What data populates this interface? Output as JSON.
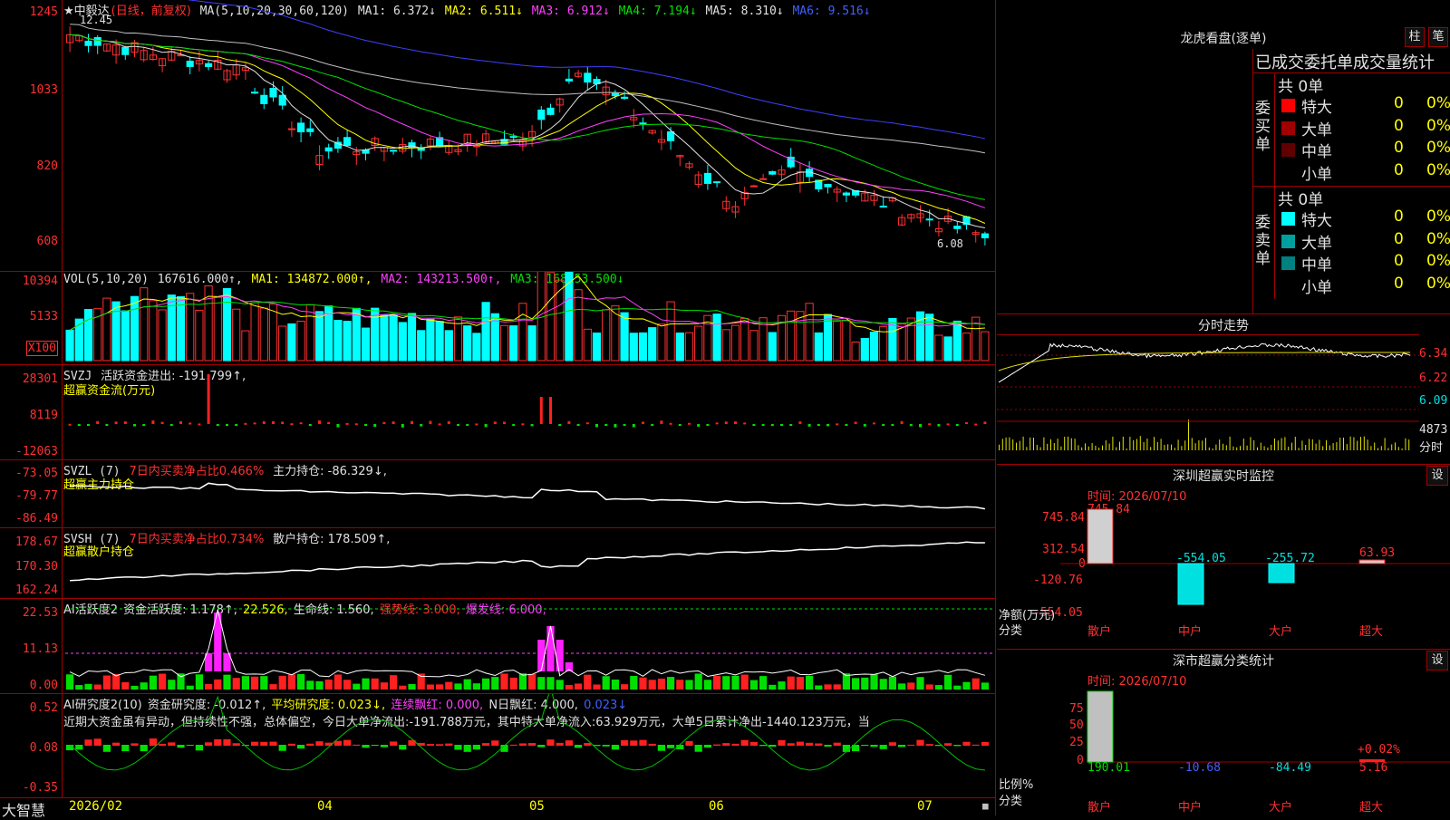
{
  "main": {
    "stock": "★中毅达",
    "period": "(日线，前复权)",
    "ma_label": "MA(5,10,20,30,60,120)",
    "ma1": "MA1: 6.372↓",
    "ma2": "MA2: 6.511↓",
    "ma3": "MA3: 6.912↓",
    "ma4": "MA4: 7.194↓",
    "ma5": "MA5: 8.310↓",
    "ma6": "MA6: 9.516↓",
    "high_mark": "12.45",
    "low_mark": "6.08",
    "y_labels": [
      "1245",
      "1033",
      "820",
      "608"
    ],
    "colors": {
      "ma1": "#e0e0e0",
      "ma2": "#ffff00",
      "ma3": "#ff40ff",
      "ma4": "#00e000",
      "ma5": "#c0c0c0",
      "ma6": "#4040ff"
    }
  },
  "vol": {
    "label": "VOL(5,10,20)",
    "value": "167616.000↑,",
    "ma1": "MA1: 134872.000↑,",
    "ma2": "MA2: 143213.500↑,",
    "ma3": "MA3: 168153.500↓",
    "y_labels": [
      "10394",
      "5133"
    ],
    "unit": "X100"
  },
  "svzj": {
    "label": "SVZJ",
    "title": "活跃资金进出: -191.799↑,",
    "sub": "超赢资金流(万元)",
    "y_labels": [
      "28301",
      "8119",
      "-12063"
    ]
  },
  "svzl": {
    "label": "SVZL (7)",
    "title": "7日内买卖净占比0.466%",
    "hold": "主力持仓: -86.329↓,",
    "sub": "超赢主力持仓",
    "y_labels": [
      "-73.05",
      "-79.77",
      "-86.49"
    ]
  },
  "svsh": {
    "label": "SVSH (7)",
    "title": "7日内买卖净占比0.734%",
    "hold": "散户持仓: 178.509↑,",
    "sub": "超赢散户持仓",
    "y_labels": [
      "178.67",
      "170.30",
      "162.24"
    ]
  },
  "ai1": {
    "label": "AI活跃度2",
    "t1": "资金活跃度: 1.178↑,",
    "t2": "22.526,",
    "t3": "生命线: 1.560,",
    "t4": "强势线: 3.000,",
    "t5": "爆发线: 6.000,",
    "y_labels": [
      "22.53",
      "11.13",
      "0.00"
    ]
  },
  "ai2": {
    "label": "AI研究度2(10)",
    "t1": "资金研究度: -0.012↑,",
    "t2": "平均研究度: 0.023↓,",
    "t3": "连续飘红: 0.000,",
    "t4": "N日飘红: 4.000,",
    "t5": "0.023↓",
    "comment": "近期大资金虽有异动，但持续性不强，总体偏空，今日大单净流出:-191.788万元，其中特大单净流入:63.929万元，大单5日累计净出-1440.123万元，当",
    "y_labels": [
      "0.52",
      "0.08",
      "-0.35"
    ]
  },
  "xaxis": {
    "brand": "大智慧",
    "labels": [
      "2026/02",
      "04",
      "05",
      "06",
      "07"
    ]
  },
  "right": {
    "lhb_title": "龙虎看盘(逐单)",
    "btn_zhu": "柱",
    "btn_bi": "笔",
    "stat_title": "已成交委托单成交量统计",
    "buy_side": "委买单",
    "sell_side": "委卖单",
    "buy_total": "共 0单",
    "sell_total": "共 0单",
    "buy_rows": [
      {
        "name": "特大",
        "count": "0",
        "pct": "0%",
        "color": "#ff0000"
      },
      {
        "name": "大单",
        "count": "0",
        "pct": "0%",
        "color": "#a00000"
      },
      {
        "name": "中单",
        "count": "0",
        "pct": "0%",
        "color": "#600000"
      },
      {
        "name": "小单",
        "count": "0",
        "pct": "0%",
        "color": "#000000"
      }
    ],
    "sell_rows": [
      {
        "name": "特大",
        "count": "0",
        "pct": "0%",
        "color": "#00ffff"
      },
      {
        "name": "大单",
        "count": "0",
        "pct": "0%",
        "color": "#00a0a0"
      },
      {
        "name": "中单",
        "count": "0",
        "pct": "0%",
        "color": "#008080"
      },
      {
        "name": "小单",
        "count": "0",
        "pct": "0%",
        "color": "#000000"
      }
    ],
    "ts_title": "分时走势",
    "ts_labels": [
      "6.34",
      "6.22",
      "6.09"
    ],
    "ts_vol": "4873",
    "ts_unit": "分时",
    "mon_title": "深圳超赢实时监控",
    "mon_btn": "设",
    "mon_time": "时间: 2026/07/10",
    "mon_y": [
      "745.84",
      "312.54",
      "0",
      "-120.76",
      "-554.05"
    ],
    "mon_vals": [
      "745.84",
      "-554.05",
      "-255.72",
      "63.93"
    ],
    "mon_ylabel": "净额(万元)",
    "mon_xlabel": "分类",
    "cat_labels": [
      "散户",
      "中户",
      "大户",
      "超大"
    ],
    "cls_title": "深市超赢分类统计",
    "cls_btn": "设",
    "cls_time": "时间: 2026/07/10",
    "cls_y": [
      "75",
      "50",
      "25",
      "0"
    ],
    "cls_vals": [
      "190.01",
      "-10.68",
      "-84.49",
      "5.16"
    ],
    "cls_top": "+0.02%",
    "cls_ylabel": "比例%",
    "cls_xlabel": "分类"
  },
  "chart_data": {
    "type": "candlestick",
    "title": "中毅达",
    "candles_x": "2026/02-2026/07",
    "ma_current": {
      "MA1": 6.372,
      "MA2": 6.511,
      "MA3": 6.912,
      "MA4": 7.194,
      "MA5": 8.31,
      "MA6": 9.516
    },
    "ylim": [
      6.08,
      12.45
    ]
  }
}
